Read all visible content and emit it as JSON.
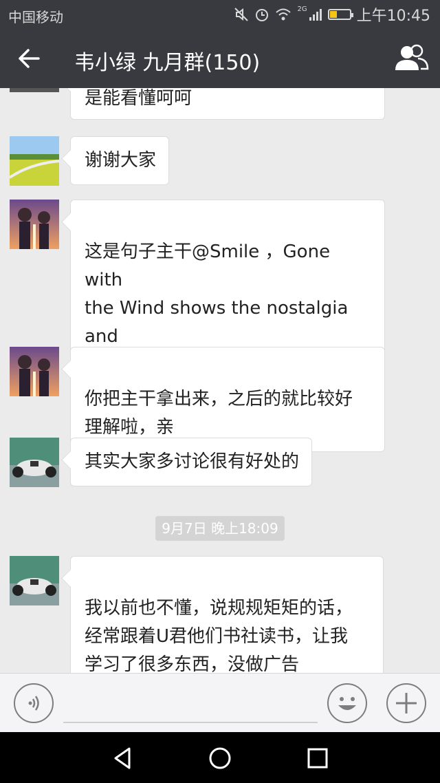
{
  "status_bar": {
    "carrier": "中国移动",
    "time": "上午10:45",
    "network": "2G",
    "icons": [
      "mute-icon",
      "alarm-icon",
      "wifi-icon",
      "signal-icon",
      "battery-icon"
    ],
    "battery_level": 0.35,
    "battery_color": "#f5c518"
  },
  "header": {
    "title": "韦小绿  九月群(150)",
    "back_icon": "arrow-left-icon",
    "members_icon": "group-members-icon"
  },
  "messages": [
    {
      "text": "是能看懂呵呵",
      "avatar": "cropped-avatar"
    },
    {
      "text": "谢谢大家",
      "avatar": "meadow-avatar"
    },
    {
      "text": "这是句子主干@Smile ，Gone with\n the Wind shows the nostalgia and\nbitterness more than the relief and\n anticipation",
      "avatar": "anime-couple-avatar"
    },
    {
      "text": "你把主干拿出来，之后的就比较好\n理解啦，亲",
      "avatar": "anime-couple-avatar"
    },
    {
      "text": "其实大家多讨论很有好处的",
      "avatar": "race-car-avatar"
    },
    {
      "text": "我以前也不懂，说规规矩矩的话，\n经常跟着U君他们书社读书，让我\n学习了很多东西，没做广告",
      "avatar": "race-car-avatar"
    }
  ],
  "timestamp": "9月7日 晚上18:09",
  "input_bar": {
    "voice_icon": "voice-icon",
    "emoji_icon": "emoji-icon",
    "plus_icon": "plus-icon"
  },
  "nav_bar": {
    "icons": [
      "back-triangle-icon",
      "home-circle-icon",
      "recents-square-icon"
    ]
  },
  "colors": {
    "header_bg": "#393a3f",
    "chat_bg": "#ebebeb",
    "bubble_bg": "#ffffff",
    "timestamp_bg": "#d4d4d4"
  }
}
